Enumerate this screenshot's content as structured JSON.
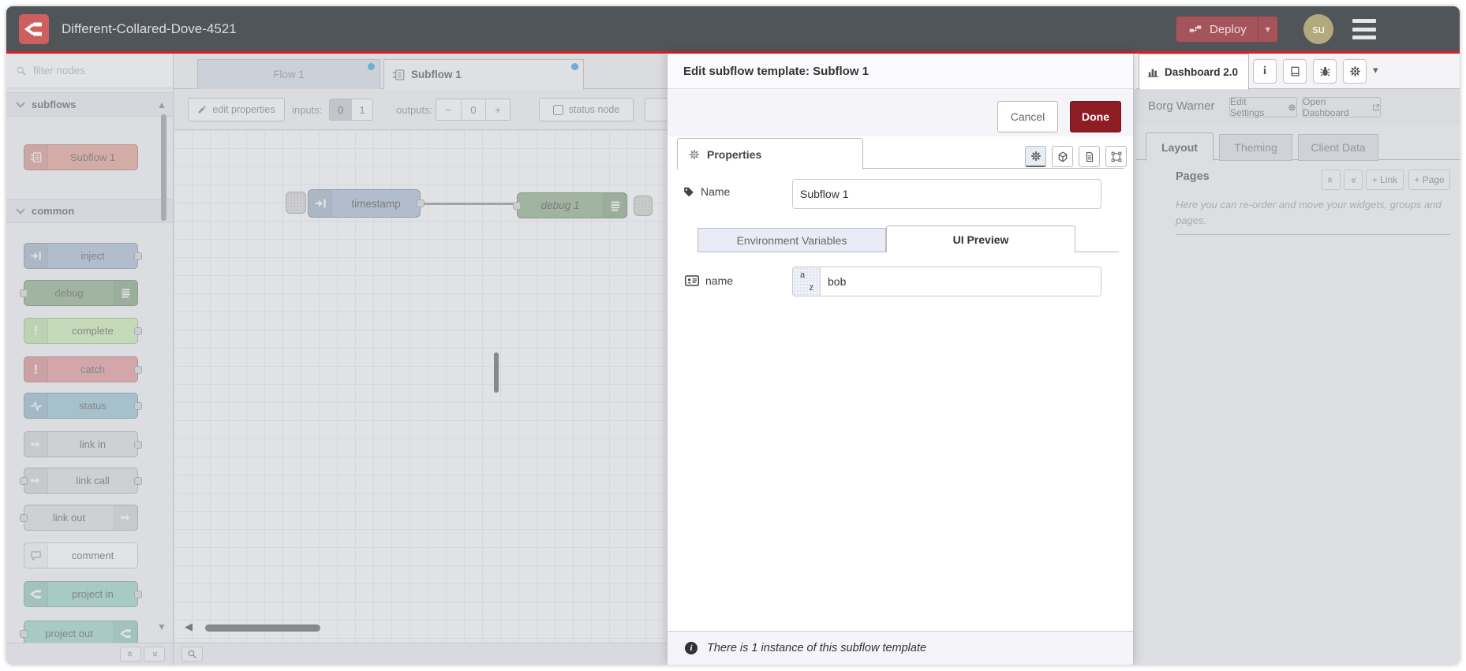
{
  "header": {
    "title": "Different-Collared-Dove-4521",
    "deploy_label": "Deploy",
    "avatar_text": "su",
    "accent_red": "#dd1e23",
    "header_bg": "#50555a",
    "logo_bg": "#cd5f5f",
    "deploy_bg": "#a6545c"
  },
  "palette": {
    "search_placeholder": "filter nodes",
    "categories": [
      {
        "label": "subflows"
      },
      {
        "label": "common"
      }
    ],
    "nodes": [
      {
        "label": "Subflow 1",
        "color": "#e59b8c",
        "icon": "subflow-icon"
      },
      {
        "label": "inject",
        "color": "#a6bbcf",
        "icon": "inject-arrow-icon"
      },
      {
        "label": "debug",
        "color": "#87a980",
        "icon": "debug-lines-icon"
      },
      {
        "label": "complete",
        "color": "#c8eeab",
        "icon": "exclamation-icon"
      },
      {
        "label": "catch",
        "color": "#e49191",
        "icon": "exclamation-icon"
      },
      {
        "label": "status",
        "color": "#94c1d0",
        "icon": "pulse-icon"
      },
      {
        "label": "link in",
        "color": "#dddddd",
        "icon": "link-icon"
      },
      {
        "label": "link call",
        "color": "#dddddd",
        "icon": "link-icon"
      },
      {
        "label": "link out",
        "color": "#dddddd",
        "icon": "link-icon"
      },
      {
        "label": "comment",
        "color": "#ffffff",
        "icon": "comment-bubble-icon"
      },
      {
        "label": "project in",
        "color": "#94d2c1",
        "icon": "node-red-icon"
      },
      {
        "label": "project out",
        "color": "#94d2c1",
        "icon": "node-red-icon"
      }
    ]
  },
  "workspace": {
    "tabs": [
      {
        "label": "Flow 1",
        "active": false
      },
      {
        "label": "Subflow 1",
        "active": true
      }
    ],
    "toolbar": {
      "edit_properties": "edit properties",
      "inputs_label": "inputs:",
      "input_zero": "0",
      "input_one": "1",
      "selected_inputs": "0",
      "outputs_label": "outputs:",
      "minus": "−",
      "output_count": "0",
      "plus": "+",
      "status_node": "status node"
    },
    "canvas": {
      "nodes": [
        {
          "label": "timestamp",
          "color": "#a6bbcf"
        },
        {
          "label": "debug 1",
          "color": "#87a980"
        }
      ]
    }
  },
  "dialog": {
    "title": "Edit subflow template: Subflow 1",
    "cancel": "Cancel",
    "done": "Done",
    "done_bg": "#8e1c24",
    "properties_tab": "Properties",
    "name_label": "Name",
    "name_value": "Subflow 1",
    "env_tab": "Environment Variables",
    "ui_tab": "UI Preview",
    "field_label": "name",
    "field_type_a": "a",
    "field_type_z": "z",
    "field_value": "bob",
    "footer": "There is 1 instance of this subflow template"
  },
  "sidebar": {
    "tab": "Dashboard 2.0",
    "project": "Borg Warner",
    "edit_settings": "Edit Settings",
    "open_dashboard": "Open Dashboard",
    "tabs": [
      "Layout",
      "Theming",
      "Client Data"
    ],
    "pages": "Pages",
    "add_link": "+ Link",
    "add_page": "+ Page",
    "help": "Here you can re-order and move your widgets, groups and pages."
  }
}
